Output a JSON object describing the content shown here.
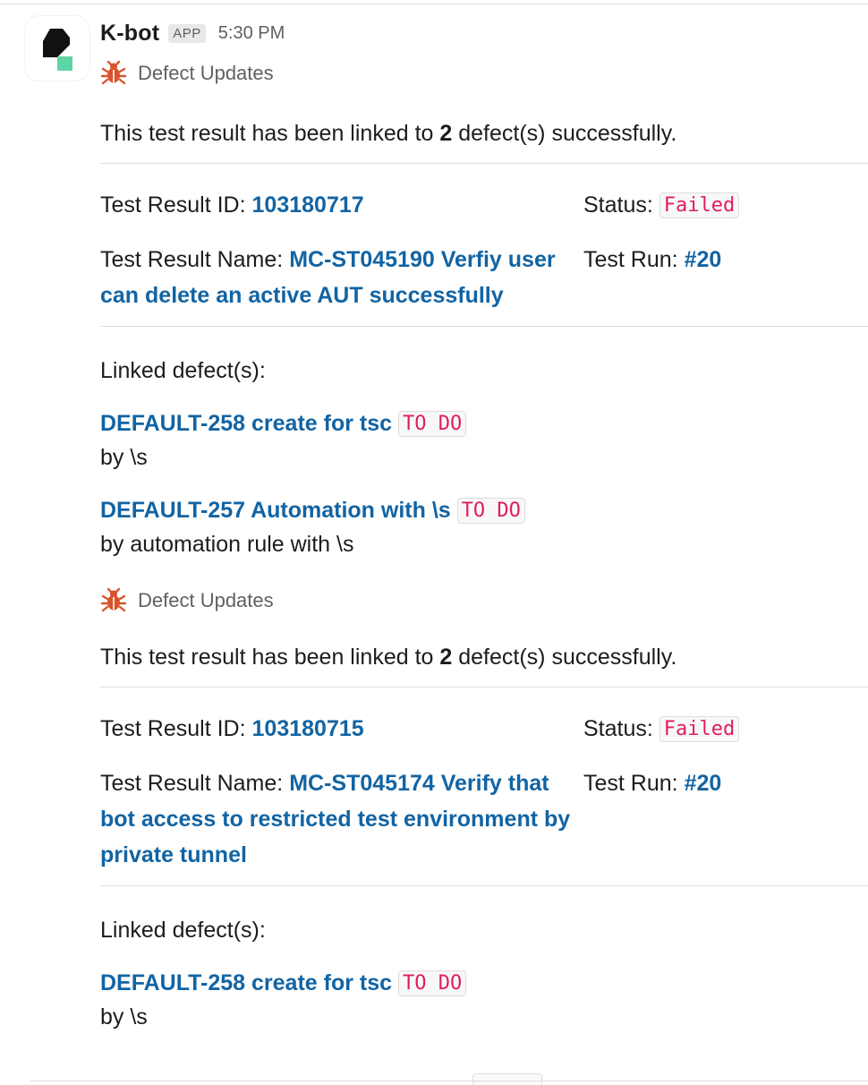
{
  "message": {
    "bot_name": "K-bot",
    "badge": "APP",
    "timestamp": "5:30 PM"
  },
  "colors": {
    "link": "#1264a3",
    "code_text": "#e01e5a",
    "avatar_dark": "#111111",
    "avatar_green": "#5fd4a6",
    "bug_icon": "#d9532c"
  },
  "icons": {
    "avatar": "k-bot-logo-icon",
    "context": "bug-icon"
  },
  "updates": [
    {
      "context_label": "Defect Updates",
      "summary_prefix": "This test result has been linked to",
      "summary_count": "2",
      "summary_suffix": "defect(s) successfully.",
      "test_result_id_label": "Test Result ID:",
      "test_result_id": "103180717",
      "status_label": "Status:",
      "status": "Failed",
      "test_result_name_label": "Test Result Name:",
      "test_result_name": "MC-ST045190 Verfiy user can delete an active AUT successfully",
      "test_run_label": "Test Run:",
      "test_run": "#20",
      "linked_heading": "Linked defect(s):",
      "defects": [
        {
          "title": "DEFAULT-258 create for tsc",
          "state": "TO DO",
          "by": "by \\s"
        },
        {
          "title": "DEFAULT-257 Automation with \\s",
          "state": "TO DO",
          "by": "by automation rule with \\s"
        }
      ]
    },
    {
      "context_label": "Defect Updates",
      "summary_prefix": "This test result has been linked to",
      "summary_count": "2",
      "summary_suffix": "defect(s) successfully.",
      "test_result_id_label": "Test Result ID:",
      "test_result_id": "103180715",
      "status_label": "Status:",
      "status": "Failed",
      "test_result_name_label": "Test Result Name:",
      "test_result_name": "MC-ST045174 Verify that bot access to restricted test environment by private tunnel",
      "test_run_label": "Test Run:",
      "test_run": "#20",
      "linked_heading": "Linked defect(s):",
      "defects": [
        {
          "title": "DEFAULT-258 create for tsc",
          "state": "TO DO",
          "by": "by \\s"
        }
      ]
    }
  ]
}
